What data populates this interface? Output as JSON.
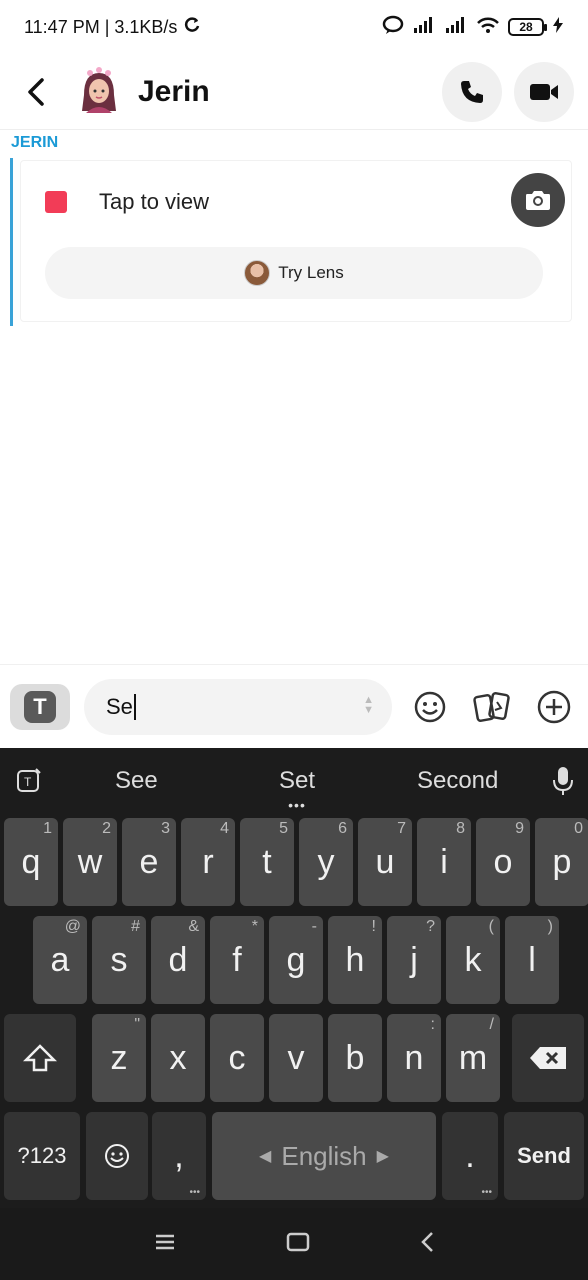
{
  "status_bar": {
    "time_speed": "11:47 PM | 3.1KB/s",
    "battery": "28"
  },
  "header": {
    "contact_name": "Jerin"
  },
  "chat": {
    "sender_label": "JERIN",
    "snap_text": "Tap to view",
    "lens_button": "Try Lens"
  },
  "composer": {
    "input_value": "Se"
  },
  "keyboard": {
    "suggestions": [
      "See",
      "Set",
      "Second"
    ],
    "row1": [
      {
        "k": "q",
        "s": "1"
      },
      {
        "k": "w",
        "s": "2"
      },
      {
        "k": "e",
        "s": "3"
      },
      {
        "k": "r",
        "s": "4"
      },
      {
        "k": "t",
        "s": "5"
      },
      {
        "k": "y",
        "s": "6"
      },
      {
        "k": "u",
        "s": "7"
      },
      {
        "k": "i",
        "s": "8"
      },
      {
        "k": "o",
        "s": "9"
      },
      {
        "k": "p",
        "s": "0"
      }
    ],
    "row2": [
      {
        "k": "a",
        "s": "@"
      },
      {
        "k": "s",
        "s": "#"
      },
      {
        "k": "d",
        "s": "&"
      },
      {
        "k": "f",
        "s": "*"
      },
      {
        "k": "g",
        "s": "-"
      },
      {
        "k": "h",
        "s": "!"
      },
      {
        "k": "j",
        "s": "?"
      },
      {
        "k": "k",
        "s": "("
      },
      {
        "k": "l",
        "s": ")"
      }
    ],
    "row3": [
      {
        "k": "z",
        "s": "\""
      },
      {
        "k": "x",
        "s": ""
      },
      {
        "k": "c",
        "s": ""
      },
      {
        "k": "v",
        "s": ""
      },
      {
        "k": "b",
        "s": ""
      },
      {
        "k": "n",
        "s": ":"
      },
      {
        "k": "m",
        "s": "/"
      }
    ],
    "symbols_key": "?123",
    "comma_key": ",",
    "space_key": "English",
    "period_key": ".",
    "send_key": "Send"
  },
  "colors": {
    "accent_blue": "#1b9ad6",
    "snap_red": "#f23c57",
    "keyboard_bg": "#1c1c1c",
    "key_bg": "#4a4a4a"
  }
}
